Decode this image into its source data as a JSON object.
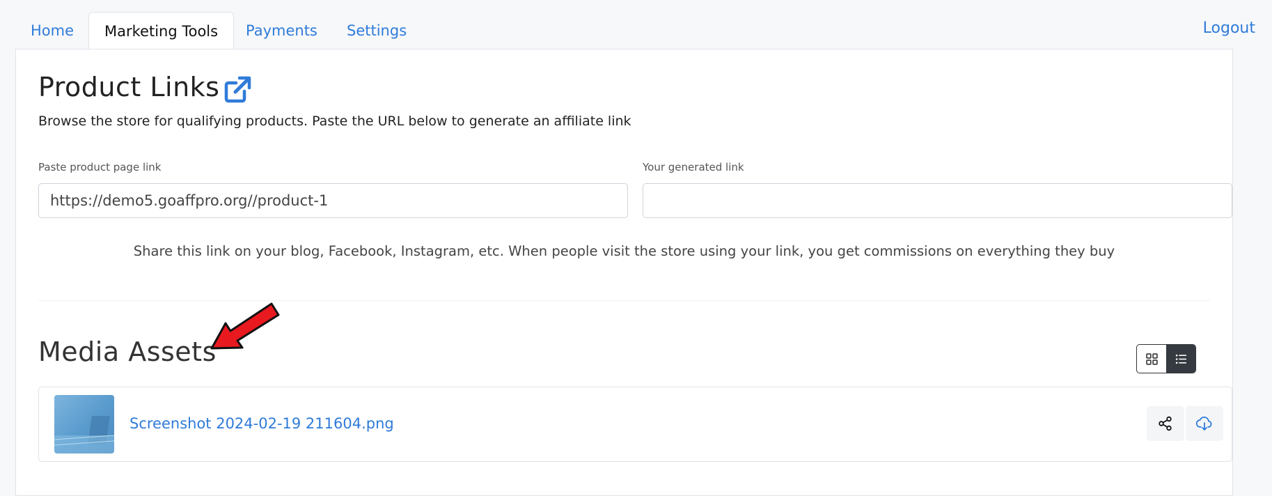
{
  "nav": {
    "tabs": [
      {
        "label": "Home"
      },
      {
        "label": "Marketing Tools"
      },
      {
        "label": "Payments"
      },
      {
        "label": "Settings"
      }
    ],
    "active_tab": "Marketing Tools",
    "logout_label": "Logout"
  },
  "product_links": {
    "title": "Product Links",
    "external_icon": "external-link-icon",
    "description": "Browse the store for qualifying products. Paste the URL below to generate an affiliate link",
    "product_input": {
      "label": "Paste product page link",
      "value": "https://demo5.goaffpro.org//product-1"
    },
    "generated_input": {
      "label": "Your generated link",
      "value": ""
    },
    "share_note": "Share this link on your blog, Facebook, Instagram, etc. When people visit the store using your link, you get commissions on everything they buy"
  },
  "media_assets": {
    "title": "Media Assets",
    "view_modes": [
      "grid-view-icon",
      "list-view-icon"
    ],
    "active_view": "list",
    "items": [
      {
        "name": "Screenshot 2024-02-19 211604.png",
        "actions": [
          "share-icon",
          "download-icon"
        ]
      }
    ]
  },
  "colors": {
    "link": "#2f7bd9",
    "annotation_arrow": "#e8191f",
    "toggle_active": "#343a40"
  }
}
